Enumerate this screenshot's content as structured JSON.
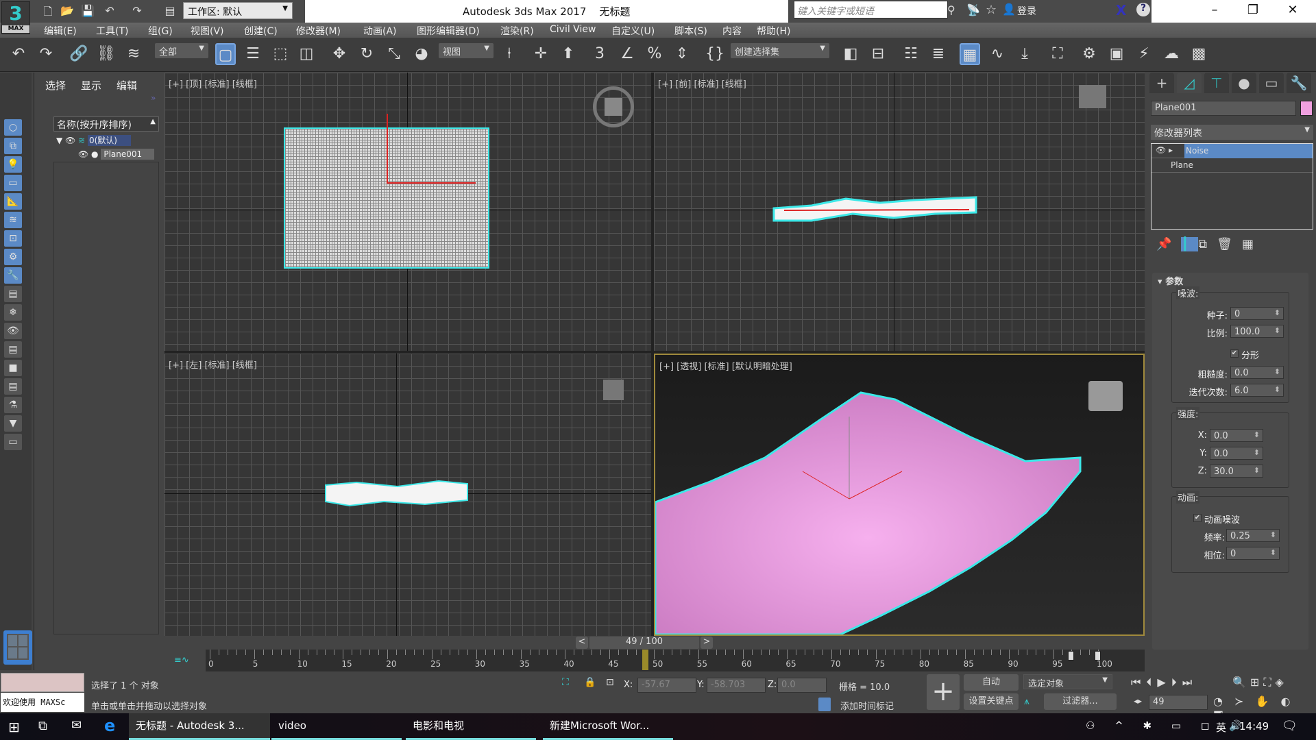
{
  "title_bar": {
    "app_title": "Autodesk 3ds Max 2017",
    "doc_title": "无标题",
    "workspace": "工作区: 默认",
    "search_placeholder": "键入关键字或短语",
    "login": "登录",
    "logo_text": "3",
    "logo_sub": "MAX"
  },
  "menu": [
    "编辑(E)",
    "工具(T)",
    "组(G)",
    "视图(V)",
    "创建(C)",
    "修改器(M)",
    "动画(A)",
    "图形编辑器(D)",
    "渲染(R)",
    "Civil View",
    "自定义(U)",
    "脚本(S)",
    "内容",
    "帮助(H)"
  ],
  "toolbar": {
    "filter": "全部",
    "ref_coord": "视图",
    "selection_set": "创建选择集"
  },
  "explorer": {
    "tabs": [
      "选择",
      "显示",
      "编辑"
    ],
    "header": "名称(按升序排序)",
    "layer": "0(默认)",
    "object": "Plane001"
  },
  "viewports": [
    {
      "label": "[+] [顶] [标准] [线框]"
    },
    {
      "label": "[+] [前] [标准] [线框]"
    },
    {
      "label": "[+] [左] [标准] [线框]"
    },
    {
      "label": "[+] [透视] [标准] [默认明暗处理]"
    }
  ],
  "timeline": {
    "frame": "49 / 100",
    "current": 49,
    "ticks": [
      "0",
      "5",
      "10",
      "15",
      "20",
      "25",
      "30",
      "35",
      "40",
      "45",
      "50",
      "55",
      "60",
      "65",
      "70",
      "75",
      "80",
      "85",
      "90",
      "95",
      "100"
    ]
  },
  "status": {
    "maxscript": "欢迎使用 MAXSc",
    "selected": "选择了 1 个 对象",
    "prompt": "单击或单击并拖动以选择对象",
    "x": "-57.67",
    "y": "-58.703",
    "z": "0.0",
    "grid": "栅格 = 10.0",
    "add_time_tag": "添加时间标记",
    "auto": "自动",
    "set_key": "设置关键点",
    "key_filter_dd": "选定对象",
    "filters": "过滤器...",
    "frame_field": "49"
  },
  "command_panel": {
    "object_name": "Plane001",
    "object_color": "#f0a0e0",
    "modifier_list": "修改器列表",
    "stack": [
      "Noise",
      "Plane"
    ],
    "rollout": "参数",
    "noise_group": "噪波:",
    "seed_label": "种子:",
    "seed": "0",
    "scale_label": "比例:",
    "scale": "100.0",
    "fractal_label": "分形",
    "fractal": true,
    "roughness_label": "粗糙度:",
    "roughness": "0.0",
    "iterations_label": "迭代次数:",
    "iterations": "6.0",
    "strength_group": "强度:",
    "x_label": "X:",
    "x": "0.0",
    "y_label": "Y:",
    "y": "0.0",
    "z_label": "Z:",
    "z": "30.0",
    "anim_group": "动画:",
    "anim_noise_label": "动画噪波",
    "anim_noise": true,
    "freq_label": "频率:",
    "freq": "0.25",
    "phase_label": "相位:",
    "phase": "0"
  },
  "taskbar": {
    "items": [
      "无标题 - Autodesk 3...",
      "video",
      "电影和电视",
      "新建Microsoft Wor..."
    ],
    "ime": "英",
    "time": "14:49"
  },
  "colors": {
    "accent": "#5b8ac6",
    "selection": "#3ce8e8",
    "object": "#f0a0e0"
  }
}
